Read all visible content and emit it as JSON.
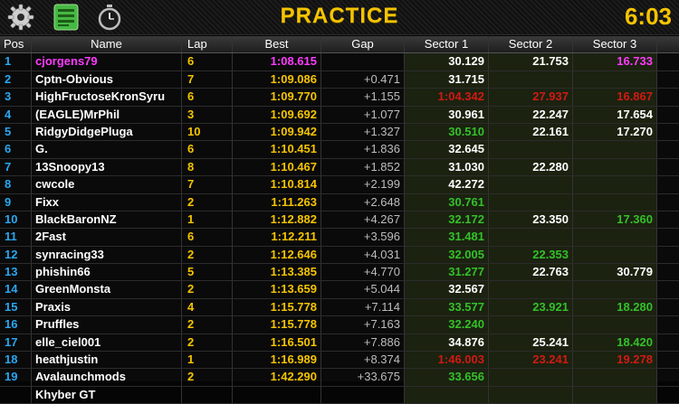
{
  "header": {
    "title": "PRACTICE",
    "clock": "6:03",
    "icons": [
      "gear-icon",
      "list-icon",
      "stopwatch-icon"
    ],
    "accent": "#f5c400"
  },
  "columns": {
    "pos": "Pos",
    "name": "Name",
    "lap": "Lap",
    "best": "Best",
    "gap": "Gap",
    "s1": "Sector 1",
    "s2": "Sector 2",
    "s3": "Sector 3"
  },
  "rows": [
    {
      "pos": "1",
      "name": "cjorgens79",
      "lap": "6",
      "best": "1:08.615",
      "gap": "",
      "s1": "30.129",
      "s2": "21.753",
      "s3": "16.733",
      "s1c": "white",
      "s2c": "white",
      "s3c": "magenta",
      "leader": true
    },
    {
      "pos": "2",
      "name": "Cptn-Obvious",
      "lap": "7",
      "best": "1:09.086",
      "gap": "+0.471",
      "s1": "31.715",
      "s2": "",
      "s3": "",
      "s1c": "white",
      "s2c": "white",
      "s3c": "white"
    },
    {
      "pos": "3",
      "name": "HighFructoseKronSyru",
      "lap": "6",
      "best": "1:09.770",
      "gap": "+1.155",
      "s1": "1:04.342",
      "s2": "27.937",
      "s3": "16.867",
      "s1c": "red",
      "s2c": "red",
      "s3c": "red"
    },
    {
      "pos": "4",
      "name": "(EAGLE)MrPhil",
      "lap": "3",
      "best": "1:09.692",
      "gap": "+1.077",
      "s1": "30.961",
      "s2": "22.247",
      "s3": "17.654",
      "s1c": "white",
      "s2c": "white",
      "s3c": "white"
    },
    {
      "pos": "5",
      "name": "RidgyDidgePluga",
      "lap": "10",
      "best": "1:09.942",
      "gap": "+1.327",
      "s1": "30.510",
      "s2": "22.161",
      "s3": "17.270",
      "s1c": "green",
      "s2c": "white",
      "s3c": "white"
    },
    {
      "pos": "6",
      "name": "G.",
      "lap": "6",
      "best": "1:10.451",
      "gap": "+1.836",
      "s1": "32.645",
      "s2": "",
      "s3": "",
      "s1c": "white",
      "s2c": "white",
      "s3c": "white"
    },
    {
      "pos": "7",
      "name": "13Snoopy13",
      "lap": "8",
      "best": "1:10.467",
      "gap": "+1.852",
      "s1": "31.030",
      "s2": "22.280",
      "s3": "",
      "s1c": "white",
      "s2c": "white",
      "s3c": "white"
    },
    {
      "pos": "8",
      "name": "cwcole",
      "lap": "7",
      "best": "1:10.814",
      "gap": "+2.199",
      "s1": "42.272",
      "s2": "",
      "s3": "",
      "s1c": "white",
      "s2c": "white",
      "s3c": "white"
    },
    {
      "pos": "9",
      "name": "Fixx",
      "lap": "2",
      "best": "1:11.263",
      "gap": "+2.648",
      "s1": "30.761",
      "s2": "",
      "s3": "",
      "s1c": "green",
      "s2c": "white",
      "s3c": "white"
    },
    {
      "pos": "10",
      "name": "BlackBaronNZ",
      "lap": "1",
      "best": "1:12.882",
      "gap": "+4.267",
      "s1": "32.172",
      "s2": "23.350",
      "s3": "17.360",
      "s1c": "green",
      "s2c": "white",
      "s3c": "green"
    },
    {
      "pos": "11",
      "name": "2Fast",
      "lap": "6",
      "best": "1:12.211",
      "gap": "+3.596",
      "s1": "31.481",
      "s2": "",
      "s3": "",
      "s1c": "green",
      "s2c": "white",
      "s3c": "white"
    },
    {
      "pos": "12",
      "name": "synracing33",
      "lap": "2",
      "best": "1:12.646",
      "gap": "+4.031",
      "s1": "32.005",
      "s2": "22.353",
      "s3": "",
      "s1c": "green",
      "s2c": "green",
      "s3c": "white"
    },
    {
      "pos": "13",
      "name": "phishin66",
      "lap": "5",
      "best": "1:13.385",
      "gap": "+4.770",
      "s1": "31.277",
      "s2": "22.763",
      "s3": "30.779",
      "s1c": "green",
      "s2c": "white",
      "s3c": "white"
    },
    {
      "pos": "14",
      "name": "GreenMonsta",
      "lap": "2",
      "best": "1:13.659",
      "gap": "+5.044",
      "s1": "32.567",
      "s2": "",
      "s3": "",
      "s1c": "white",
      "s2c": "white",
      "s3c": "white"
    },
    {
      "pos": "15",
      "name": "Praxis",
      "lap": "4",
      "best": "1:15.778",
      "gap": "+7.114",
      "s1": "33.577",
      "s2": "23.921",
      "s3": "18.280",
      "s1c": "green",
      "s2c": "green",
      "s3c": "green"
    },
    {
      "pos": "16",
      "name": "Pruffles",
      "lap": "2",
      "best": "1:15.778",
      "gap": "+7.163",
      "s1": "32.240",
      "s2": "",
      "s3": "",
      "s1c": "green",
      "s2c": "white",
      "s3c": "white"
    },
    {
      "pos": "17",
      "name": "elle_ciel001",
      "lap": "2",
      "best": "1:16.501",
      "gap": "+7.886",
      "s1": "34.876",
      "s2": "25.241",
      "s3": "18.420",
      "s1c": "white",
      "s2c": "white",
      "s3c": "green"
    },
    {
      "pos": "18",
      "name": "heathjustin",
      "lap": "1",
      "best": "1:16.989",
      "gap": "+8.374",
      "s1": "1:46.003",
      "s2": "23.241",
      "s3": "19.278",
      "s1c": "red",
      "s2c": "red",
      "s3c": "red"
    },
    {
      "pos": "19",
      "name": "Avalaunchmods",
      "lap": "2",
      "best": "1:42.290",
      "gap": "+33.675",
      "s1": "33.656",
      "s2": "",
      "s3": "",
      "s1c": "green",
      "s2c": "white",
      "s3c": "white"
    },
    {
      "pos": "",
      "name": "Khyber GT",
      "lap": "",
      "best": "",
      "gap": "",
      "s1": "",
      "s2": "",
      "s3": "",
      "s1c": "white",
      "s2c": "white",
      "s3c": "white"
    }
  ]
}
